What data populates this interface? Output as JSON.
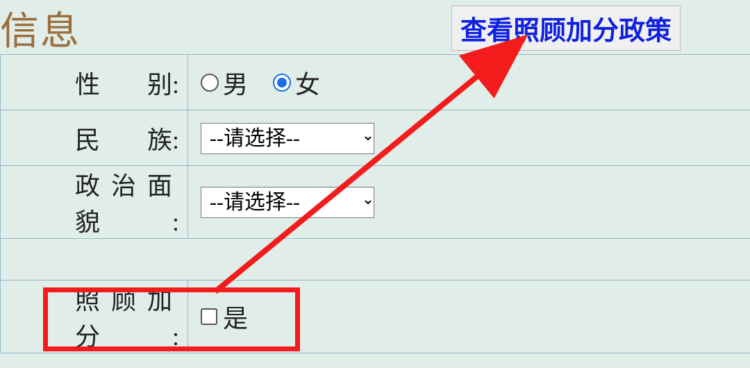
{
  "heading": "信息",
  "policy_link_label": "查看照顾加分政策",
  "fields": {
    "gender": {
      "label": "性别",
      "option_male": "男",
      "option_female": "女"
    },
    "ethnicity": {
      "label": "民族",
      "placeholder": "--请选择--"
    },
    "political": {
      "label": "政治面貌",
      "placeholder": "--请选择--"
    },
    "bonus": {
      "label": "照顾加分",
      "option_yes": "是"
    }
  },
  "colors": {
    "accent_red": "#f21c1c",
    "link_blue": "#1020e0",
    "heading_color": "#9b6e3e"
  }
}
